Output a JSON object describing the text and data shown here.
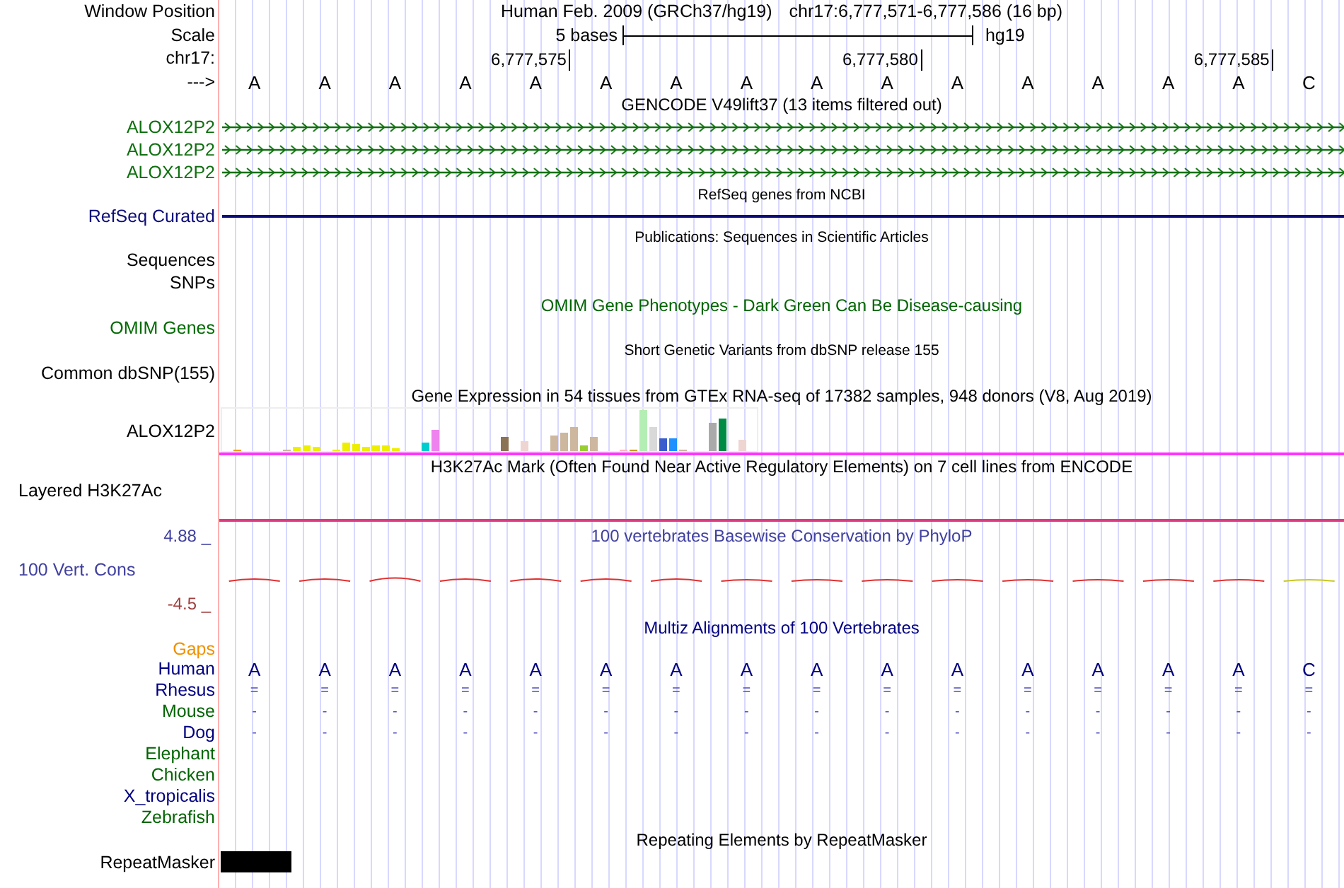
{
  "header": {
    "label": "Window Position",
    "assembly": "Human Feb. 2009 (GRCh37/hg19)",
    "position": "chr17:6,777,571-6,777,586 (16 bp)"
  },
  "scale": {
    "label": "Scale",
    "ruler_text": "5 bases",
    "assembly": "hg19"
  },
  "coordinates": {
    "label": "chr17:",
    "ticks": [
      "6,777,575",
      "6,777,580",
      "6,777,585"
    ]
  },
  "sequence": {
    "label": "--->",
    "bases": [
      "A",
      "A",
      "A",
      "A",
      "A",
      "A",
      "A",
      "A",
      "A",
      "A",
      "A",
      "A",
      "A",
      "A",
      "A",
      "C"
    ]
  },
  "tracks": [
    {
      "kind": "title",
      "text": "GENCODE V49lift37 (13 items filtered out)"
    },
    {
      "kind": "gene",
      "label": "ALOX12P2"
    },
    {
      "kind": "gene",
      "label": "ALOX12P2"
    },
    {
      "kind": "gene",
      "label": "ALOX12P2"
    },
    {
      "kind": "small_title",
      "text": "RefSeq genes from NCBI"
    },
    {
      "kind": "refseq",
      "label": "RefSeq Curated"
    },
    {
      "kind": "small_title",
      "text": "Publications: Sequences in Scientific Articles"
    },
    {
      "kind": "empty",
      "label": "Sequences"
    },
    {
      "kind": "empty",
      "label": "SNPs"
    },
    {
      "kind": "omim_title",
      "text": "OMIM Gene Phenotypes - Dark Green Can Be Disease-causing"
    },
    {
      "kind": "omim",
      "label": "OMIM Genes"
    },
    {
      "kind": "small_title",
      "text": "Short Genetic Variants from dbSNP release 155"
    },
    {
      "kind": "empty",
      "label": "Common dbSNP(155)"
    },
    {
      "kind": "title",
      "text": "Gene Expression in 54 tissues from GTEx RNA-seq of 17382 samples, 948 donors (V8, Aug 2019)"
    },
    {
      "kind": "expression",
      "label": "ALOX12P2"
    },
    {
      "kind": "title",
      "text": "H3K27Ac Mark (Often Found Near Active Regulatory Elements) on 7 cell lines from ENCODE"
    },
    {
      "kind": "h3k27ac",
      "label": "Layered H3K27Ac"
    },
    {
      "kind": "conservation",
      "title": "100 vertebrates Basewise Conservation by PhyloP",
      "label": "100 Vert. Cons",
      "max": "4.88 _",
      "min": "-4.5 _"
    },
    {
      "kind": "multiz",
      "title": "Multiz Alignments of 100 Vertebrates",
      "gaps": "Gaps",
      "species": [
        {
          "name": "Human",
          "color": "#000080",
          "bases": [
            "A",
            "A",
            "A",
            "A",
            "A",
            "A",
            "A",
            "A",
            "A",
            "A",
            "A",
            "A",
            "A",
            "A",
            "A",
            "C"
          ]
        },
        {
          "name": "Rhesus",
          "color": "#000080",
          "bases": [
            "=",
            "=",
            "=",
            "=",
            "=",
            "=",
            "=",
            "=",
            "=",
            "=",
            "=",
            "=",
            "=",
            "=",
            "=",
            "="
          ]
        },
        {
          "name": "Mouse",
          "color": "#006400",
          "bases": [
            "-",
            "-",
            "-",
            "-",
            "-",
            "-",
            "-",
            "-",
            "-",
            "-",
            "-",
            "-",
            "-",
            "-",
            "-",
            "-"
          ]
        },
        {
          "name": "Dog",
          "color": "#000080",
          "bases": [
            "-",
            "-",
            "-",
            "-",
            "-",
            "-",
            "-",
            "-",
            "-",
            "-",
            "-",
            "-",
            "-",
            "-",
            "-",
            "-"
          ]
        },
        {
          "name": "Elephant",
          "color": "#006400"
        },
        {
          "name": "Chicken",
          "color": "#006400"
        },
        {
          "name": "X_tropicalis",
          "color": "#000080"
        },
        {
          "name": "Zebrafish",
          "color": "#006400"
        }
      ]
    },
    {
      "kind": "title",
      "text": "Repeating Elements by RepeatMasker"
    },
    {
      "kind": "repeatmasker",
      "label": "RepeatMasker"
    }
  ]
}
